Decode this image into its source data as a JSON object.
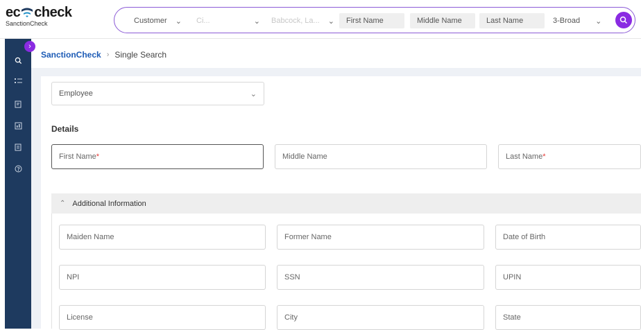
{
  "app": {
    "logo_main": "ec check",
    "logo_sub": "SanctionCheck"
  },
  "search": {
    "entity_type": "Customer",
    "location_placeholder": "Ci...",
    "org_placeholder": "Babcock, La...",
    "first_name": "First Name",
    "middle_name": "Middle Name",
    "last_name": "Last Name",
    "match_mode": "3-Broad"
  },
  "breadcrumb": {
    "root": "SanctionCheck",
    "current": "Single Search"
  },
  "form": {
    "type_value": "Employee",
    "details_title": "Details",
    "first_name_label": "First Name",
    "middle_name_label": "Middle Name",
    "last_name_label": "Last Name",
    "required_mark": "*",
    "additional_title": "Additional Information",
    "maiden_name": "Maiden Name",
    "former_name": "Former Name",
    "date_of_birth": "Date of Birth",
    "npi": "NPI",
    "ssn": "SSN",
    "upin": "UPIN",
    "license": "License",
    "city": "City",
    "state": "State"
  },
  "colors": {
    "accent": "#8a2be2",
    "sidebar": "#1e3a5f",
    "link": "#1b5ab5"
  },
  "icons": {
    "sidebar": [
      "search-icon",
      "list-icon",
      "report-icon",
      "chart-icon",
      "document-icon",
      "help-icon"
    ],
    "toggle": "chevron-right-icon"
  }
}
